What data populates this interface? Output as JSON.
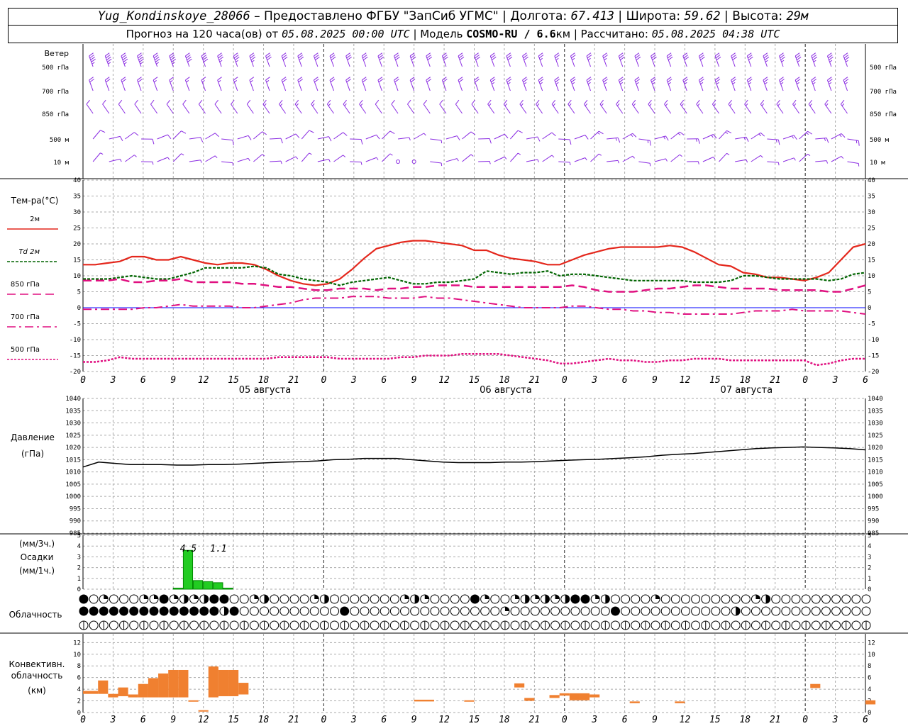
{
  "header": {
    "station": "Yug_Kondinskoye_28066",
    "provider": "– Предоставлено ФГБУ \"ЗапСиб УГМС\"",
    "lon_label": "Долгота:",
    "lon": "67.413",
    "lat_label": "Широта:",
    "lat": "59.62",
    "alt_label": "Высота:",
    "alt": "29м",
    "forecast_label": "Прогноз на 120 часа(ов) от",
    "start": "05.08.2025 00:00 UTC",
    "model_label": "Модель",
    "model": "COSMO-RU / 6.6",
    "model_unit": "км",
    "calc_label": "Рассчитано:",
    "calc": "05.08.2025 04:38 UTC"
  },
  "chart_data": [
    {
      "type": "line",
      "title": "Ветер",
      "levels": [
        "500 гПа",
        "700 гПа",
        "850 гПа",
        "500 м",
        "10 м"
      ],
      "series": [
        {
          "name": "500 гПа",
          "speed": [
            45,
            45,
            45,
            45,
            45,
            45,
            40,
            40,
            35,
            35,
            35,
            30,
            30,
            30,
            30,
            30,
            30,
            30,
            30,
            30,
            30,
            30,
            30,
            30,
            30,
            30,
            30,
            30,
            25,
            25,
            25,
            25,
            25,
            30,
            30,
            30,
            30,
            30,
            30,
            30,
            30,
            30,
            35,
            35,
            35,
            35,
            35,
            35
          ]
        },
        {
          "name": "700 гПа",
          "speed": [
            20,
            20,
            20,
            20,
            15,
            15,
            15,
            15,
            15,
            15,
            15,
            15,
            20,
            20,
            20,
            20,
            20,
            20,
            20,
            20,
            20,
            20,
            20,
            20,
            20,
            25,
            25,
            25,
            25,
            25,
            25,
            25,
            25,
            25,
            25,
            25,
            25,
            25,
            25,
            25,
            25,
            25,
            25,
            25,
            25,
            25,
            25,
            25
          ]
        },
        {
          "name": "850 гПа",
          "speed": [
            10,
            10,
            10,
            10,
            10,
            10,
            10,
            10,
            10,
            10,
            10,
            15,
            15,
            15,
            15,
            15,
            15,
            15,
            10,
            10,
            10,
            10,
            10,
            10,
            10,
            15,
            15,
            15,
            15,
            15,
            15,
            15,
            15,
            15,
            15,
            15,
            15,
            15,
            15,
            15,
            15,
            15,
            15,
            15,
            15,
            15,
            15,
            15
          ]
        },
        {
          "name": "500 м",
          "speed": [
            10,
            10,
            10,
            10,
            10,
            10,
            10,
            10,
            10,
            10,
            10,
            10,
            10,
            10,
            10,
            10,
            10,
            10,
            10,
            5,
            5,
            5,
            10,
            10,
            10,
            10,
            10,
            10,
            10,
            10,
            10,
            15,
            15,
            15,
            15,
            15,
            15,
            15,
            15,
            15,
            15,
            15,
            15,
            15,
            15,
            15,
            15,
            15
          ]
        },
        {
          "name": "10 м",
          "speed": [
            5,
            5,
            5,
            5,
            5,
            5,
            5,
            5,
            5,
            5,
            5,
            5,
            5,
            5,
            5,
            5,
            5,
            5,
            5,
            0,
            0,
            5,
            5,
            5,
            5,
            5,
            5,
            5,
            5,
            5,
            5,
            5,
            5,
            5,
            5,
            5,
            5,
            5,
            5,
            5,
            5,
            5,
            5,
            5,
            5,
            5,
            5,
            5
          ]
        }
      ]
    },
    {
      "type": "line",
      "title": "Тем-ра(°C)",
      "ylim": [
        -20,
        40
      ],
      "yticks": [
        40,
        35,
        30,
        25,
        20,
        15,
        10,
        5,
        0,
        -5,
        -10,
        -15,
        -20
      ],
      "x_hours": [
        0,
        3,
        6,
        9,
        12,
        15,
        18,
        21,
        0,
        3,
        6,
        9,
        12,
        15,
        18,
        21,
        0,
        3,
        6,
        9,
        12,
        15,
        18,
        21,
        0,
        3,
        6
      ],
      "dates": [
        "05 августа",
        "06 августа",
        "07 августа"
      ],
      "series": [
        {
          "name": "2м",
          "values": [
            13.5,
            13.5,
            14,
            14.5,
            16,
            16,
            15,
            15,
            16,
            15,
            14,
            13.5,
            14,
            14,
            13.5,
            12,
            10,
            8.5,
            7.5,
            7,
            7.5,
            9,
            12,
            15.5,
            18.5,
            19.5,
            20.5,
            21,
            21,
            20.5,
            20,
            19.5,
            18,
            18,
            16.5,
            15.5,
            15,
            14.5,
            13.5,
            13.5,
            15,
            16.5,
            17.5,
            18.5,
            19,
            19,
            19,
            19,
            19.5,
            19,
            17.5,
            15.5,
            13.5,
            13,
            11,
            10.5,
            9.5,
            9.5,
            9,
            8.5,
            9.5,
            11,
            15,
            19,
            20
          ]
        },
        {
          "name": "Td 2м",
          "values": [
            9,
            9,
            9,
            9.5,
            10,
            9.5,
            9,
            9,
            10,
            11,
            12.5,
            12.5,
            12.5,
            12.5,
            13,
            12.5,
            10.5,
            10,
            9,
            8.5,
            8,
            7,
            8,
            8.5,
            9,
            9.5,
            8.5,
            7.5,
            7.5,
            8,
            8,
            8.5,
            9,
            11.5,
            11,
            10.5,
            11,
            11,
            11.5,
            10,
            10.5,
            10.5,
            10,
            9.5,
            9,
            8.5,
            8.5,
            8.5,
            8.5,
            8.5,
            8,
            8,
            8,
            8.5,
            10,
            10,
            9.5,
            9,
            9,
            9,
            9,
            8.5,
            9,
            10.5,
            11
          ]
        },
        {
          "name": "850 гПа",
          "values": [
            8.5,
            8.5,
            8.5,
            9,
            8,
            8,
            8.5,
            8.5,
            9,
            8,
            8,
            8,
            8,
            7.5,
            7.5,
            7,
            6.5,
            6.5,
            6,
            5.5,
            5.5,
            6,
            6,
            6,
            5.5,
            6,
            6,
            6.5,
            6.5,
            7,
            7,
            7,
            6.5,
            6.5,
            6.5,
            6.5,
            6.5,
            6.5,
            6.5,
            6.5,
            7,
            6.5,
            5.5,
            5,
            5,
            5,
            5.5,
            6,
            6,
            6.5,
            7,
            7,
            6.5,
            6,
            6,
            6,
            6,
            5.5,
            5.5,
            5.5,
            5.5,
            5,
            5,
            6,
            7
          ]
        },
        {
          "name": "700 гПа",
          "values": [
            -0.5,
            -0.5,
            -0.5,
            -0.5,
            -0.5,
            0,
            0,
            0.5,
            1,
            0.5,
            0.5,
            0.5,
            0.5,
            0,
            0,
            0.5,
            1,
            1.5,
            2.5,
            3,
            3,
            3,
            3.5,
            3.5,
            3.5,
            3,
            3,
            3,
            3.5,
            3,
            3,
            2.5,
            2,
            1.5,
            1,
            0.5,
            0,
            0,
            0,
            0,
            0.5,
            0.5,
            0,
            -0.5,
            -0.5,
            -1,
            -1,
            -1.5,
            -1.5,
            -2,
            -2,
            -2,
            -2,
            -2,
            -1.5,
            -1,
            -1,
            -1,
            -0.5,
            -1,
            -1,
            -1,
            -1,
            -1.5,
            -2
          ]
        },
        {
          "name": "500 гПа",
          "values": [
            -17,
            -17,
            -16.5,
            -15.5,
            -16,
            -16,
            -16,
            -16,
            -16,
            -16,
            -16,
            -16,
            -16,
            -16,
            -16,
            -16,
            -15.5,
            -15.5,
            -15.5,
            -15.5,
            -15.5,
            -16,
            -16,
            -16,
            -16,
            -16,
            -15.5,
            -15.5,
            -15,
            -15,
            -15,
            -14.5,
            -14.5,
            -14.5,
            -14.5,
            -15,
            -15.5,
            -16,
            -16.5,
            -17.5,
            -17.5,
            -17,
            -16.5,
            -16,
            -16.5,
            -16.5,
            -17,
            -17,
            -16.5,
            -16.5,
            -16,
            -16,
            -16,
            -16.5,
            -16.5,
            -16.5,
            -16.5,
            -16.5,
            -16.5,
            -16.5,
            -18,
            -17.5,
            -16.5,
            -16,
            -16
          ]
        }
      ]
    },
    {
      "type": "line",
      "title": "Давление",
      "ylabel": "(гПа)",
      "ylim": [
        985,
        1040
      ],
      "yticks": [
        1040,
        1035,
        1030,
        1025,
        1020,
        1015,
        1010,
        1005,
        1000,
        995,
        990,
        985
      ],
      "series": [
        {
          "name": "Давление",
          "values": [
            1012,
            1014,
            1013.5,
            1013,
            1013,
            1013,
            1012.8,
            1012.8,
            1013,
            1013,
            1013.2,
            1013.5,
            1013.8,
            1014,
            1014.2,
            1014.5,
            1015,
            1015.2,
            1015.5,
            1015.5,
            1015.5,
            1015,
            1014.5,
            1014,
            1013.8,
            1013.8,
            1013.8,
            1014,
            1014,
            1014.2,
            1014.5,
            1014.8,
            1015,
            1015.2,
            1015.5,
            1015.8,
            1016.2,
            1016.8,
            1017.2,
            1017.5,
            1018,
            1018.5,
            1019,
            1019.5,
            1019.8,
            1020,
            1020.2,
            1020,
            1019.8,
            1019.5,
            1019
          ]
        }
      ]
    },
    {
      "type": "bar",
      "title": "Осадки",
      "ylabel_top": "(мм/3ч.)",
      "ylabel_bottom": "(мм/1ч.)",
      "ylim": [
        0,
        5
      ],
      "yticks": [
        5,
        4,
        3,
        2,
        1,
        0
      ],
      "annotations": [
        "4.5",
        "1.1"
      ],
      "hourly_bars": [
        {
          "hour": 9,
          "value": 0.1
        },
        {
          "hour": 10,
          "value": 3.6
        },
        {
          "hour": 11,
          "value": 0.8
        },
        {
          "hour": 12,
          "value": 0.7
        },
        {
          "hour": 13,
          "value": 0.6
        },
        {
          "hour": 14,
          "value": 0.1
        }
      ]
    },
    {
      "type": "table",
      "title": "Облачность",
      "rows": [
        "4010001141212440012000012000000012100004100121212441200001000000000120000000000120000000000",
        "4444444444444424000000000040000000000000001000000000040000000000020000000000000000100000000",
        "0000000000000000000000000000000000000000000000000000000000000000000000000000000000000000000"
      ]
    },
    {
      "type": "bar",
      "title": "Конвективн. облачность",
      "ylabel": "(км)",
      "ylim": [
        0,
        12
      ],
      "yticks": [
        12,
        10,
        8,
        6,
        4,
        2,
        0
      ],
      "bars": [
        {
          "h": 0,
          "w": 1.5,
          "lo": 3.2,
          "hi": 3.7
        },
        {
          "h": 1.5,
          "w": 1,
          "lo": 3.2,
          "hi": 5.5
        },
        {
          "h": 2.5,
          "w": 1,
          "lo": 2.6,
          "hi": 3.2
        },
        {
          "h": 3.5,
          "w": 1,
          "lo": 2.8,
          "hi": 4.3
        },
        {
          "h": 4.5,
          "w": 1,
          "lo": 2.6,
          "hi": 3.1
        },
        {
          "h": 5.5,
          "w": 1,
          "lo": 2.6,
          "hi": 4.9
        },
        {
          "h": 6.5,
          "w": 1,
          "lo": 2.6,
          "hi": 5.9
        },
        {
          "h": 7.5,
          "w": 1,
          "lo": 2.6,
          "hi": 6.7
        },
        {
          "h": 8.5,
          "w": 1,
          "lo": 2.6,
          "hi": 7.3
        },
        {
          "h": 9.5,
          "w": 1,
          "lo": 2.6,
          "hi": 7.3
        },
        {
          "h": 10.5,
          "w": 1,
          "lo": 1.9,
          "hi": 2.1
        },
        {
          "h": 11.5,
          "w": 1,
          "lo": 0.3,
          "hi": 0.4
        },
        {
          "h": 12.5,
          "w": 1,
          "lo": 2.6,
          "hi": 7.9
        },
        {
          "h": 13.5,
          "w": 1,
          "lo": 2.8,
          "hi": 7.3
        },
        {
          "h": 14.5,
          "w": 1,
          "lo": 2.8,
          "hi": 7.3
        },
        {
          "h": 15.5,
          "w": 1,
          "lo": 3.1,
          "hi": 5.1
        },
        {
          "h": 33,
          "w": 2,
          "lo": 1.9,
          "hi": 2.2
        },
        {
          "h": 38,
          "w": 1,
          "lo": 1.9,
          "hi": 2.1
        },
        {
          "h": 43,
          "w": 1,
          "lo": 4.3,
          "hi": 5.0
        },
        {
          "h": 44,
          "w": 1,
          "lo": 2.0,
          "hi": 2.5
        },
        {
          "h": 46.5,
          "w": 1,
          "lo": 2.5,
          "hi": 3.0
        },
        {
          "h": 47.5,
          "w": 1,
          "lo": 2.9,
          "hi": 3.3
        },
        {
          "h": 48.5,
          "w": 1,
          "lo": 2.1,
          "hi": 3.3
        },
        {
          "h": 49.5,
          "w": 1,
          "lo": 2.1,
          "hi": 3.3
        },
        {
          "h": 50.5,
          "w": 1,
          "lo": 2.6,
          "hi": 3.1
        },
        {
          "h": 54.5,
          "w": 1,
          "lo": 1.6,
          "hi": 1.9
        },
        {
          "h": 59,
          "w": 1,
          "lo": 1.6,
          "hi": 1.9
        },
        {
          "h": 72.5,
          "w": 1,
          "lo": 4.2,
          "hi": 4.9
        },
        {
          "h": 78,
          "w": 1,
          "lo": 1.4,
          "hi": 2.1
        }
      ]
    }
  ],
  "temp_legend": [
    {
      "label": "2м",
      "color": "#e4271c",
      "dash": ""
    },
    {
      "label": "Td 2м",
      "color": "#006400",
      "dash": "4 2"
    },
    {
      "label": "850 гПа",
      "color": "#e01080",
      "dash": "12 6"
    },
    {
      "label": "700 гПа",
      "color": "#e01080",
      "dash": "12 5 3 5"
    },
    {
      "label": "500 гПа",
      "color": "#e01080",
      "dash": "3 2"
    }
  ],
  "colors": {
    "temp2m": "#e4271c",
    "td": "#006400",
    "upper": "#e01080",
    "wind": "#8a2be2",
    "pressure": "#000000",
    "precip": "#22cc22",
    "convective": "#f08030",
    "zero_line": "#0000ff"
  }
}
